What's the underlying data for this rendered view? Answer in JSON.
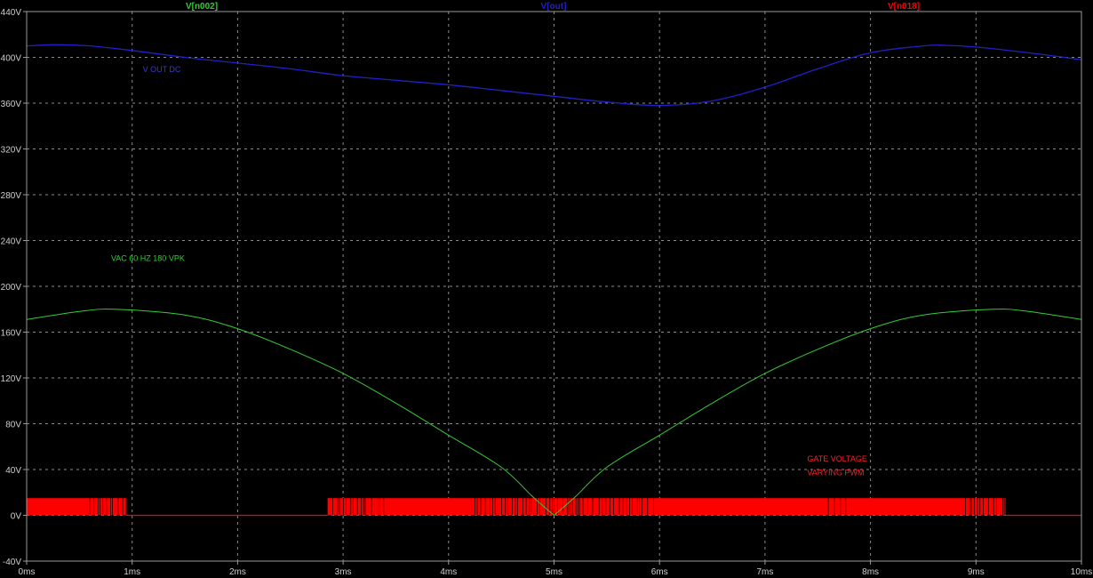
{
  "colors": {
    "background": "#000000",
    "grid": "#8a8a8a",
    "axis_text": "#cfcfcf",
    "frame": "#9a9a9a"
  },
  "chart_data": {
    "type": "line",
    "title": "",
    "xlabel": "",
    "ylabel": "",
    "xlim": [
      0,
      10
    ],
    "ylim": [
      -40,
      440
    ],
    "x_unit": "ms",
    "y_unit": "V",
    "grid": true,
    "x_ticks": [
      "0ms",
      "1ms",
      "2ms",
      "3ms",
      "4ms",
      "5ms",
      "6ms",
      "7ms",
      "8ms",
      "9ms",
      "10ms"
    ],
    "y_ticks": [
      "-40V",
      "0V",
      "40V",
      "80V",
      "120V",
      "160V",
      "200V",
      "240V",
      "280V",
      "320V",
      "360V",
      "400V",
      "440V"
    ],
    "legend_position": "top",
    "series": [
      {
        "name": "V[n002]",
        "color": "#33cc33",
        "x": [
          0,
          0.5,
          0.83,
          1.5,
          2,
          2.5,
          3,
          3.5,
          4,
          4.5,
          4.8,
          5.0,
          5.2,
          5.5,
          6,
          6.5,
          7,
          7.5,
          8,
          8.5,
          9.17,
          9.5,
          10
        ],
        "y": [
          171,
          178,
          180,
          175,
          163,
          145,
          124,
          98,
          70,
          42,
          16,
          0,
          16,
          42,
          70,
          98,
          124,
          145,
          163,
          175,
          180,
          178,
          171
        ]
      },
      {
        "name": "V[out]",
        "color": "#2020c8",
        "x": [
          0,
          0.3,
          0.6,
          1,
          1.5,
          2,
          2.5,
          3,
          3.5,
          4,
          4.5,
          5,
          5.5,
          6,
          6.5,
          7,
          7.5,
          8,
          8.5,
          8.7,
          9,
          9.5,
          10
        ],
        "y": [
          410,
          411,
          410,
          406,
          400,
          395,
          390,
          384,
          380,
          376,
          371,
          366,
          361,
          358,
          362,
          374,
          390,
          404,
          410,
          410.5,
          409,
          404,
          398
        ]
      },
      {
        "name": "V[n018]",
        "color": "#ff0000",
        "pwm_high": 15,
        "pwm_low": 0,
        "active_intervals": [
          [
            0,
            0.95
          ],
          [
            2.85,
            9.28
          ]
        ],
        "low_intervals": [
          [
            0.95,
            2.85
          ],
          [
            9.28,
            10
          ]
        ]
      }
    ],
    "annotations": [
      {
        "text": "V OUT DC",
        "x": 1.1,
        "y": 387,
        "color": "#3a3ad8"
      },
      {
        "text": "VAC 60 HZ 180 VPK",
        "x": 0.8,
        "y": 222,
        "color": "#33cc33"
      },
      {
        "text": "GATE VOLTAGE",
        "x": 7.4,
        "y": 47,
        "color": "#ff2020"
      },
      {
        "text": "VARYING PWM",
        "x": 7.4,
        "y": 35,
        "color": "#ff2020"
      }
    ]
  }
}
